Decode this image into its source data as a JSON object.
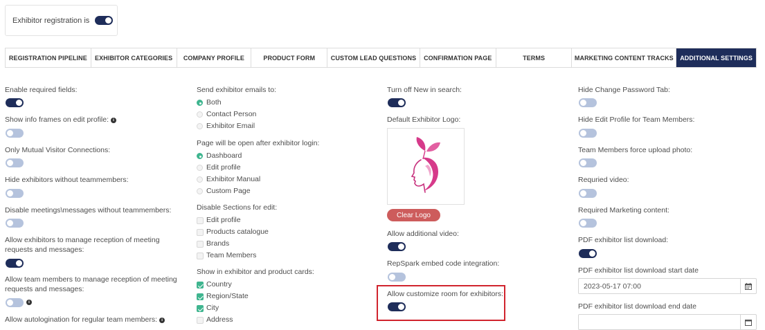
{
  "registration": {
    "label": "Exhibitor registration is",
    "enabled": true
  },
  "tabs": [
    {
      "label": "REGISTRATION PIPELINE",
      "active": false
    },
    {
      "label": "EXHIBITOR CATEGORIES",
      "active": false
    },
    {
      "label": "COMPANY PROFILE",
      "active": false
    },
    {
      "label": "PRODUCT FORM",
      "active": false
    },
    {
      "label": "CUSTOM LEAD QUESTIONS",
      "active": false
    },
    {
      "label": "CONFIRMATION PAGE",
      "active": false
    },
    {
      "label": "TERMS",
      "active": false
    },
    {
      "label": "MARKETING CONTENT TRACKS",
      "active": false
    },
    {
      "label": "ADDITIONAL SETTINGS",
      "active": true
    }
  ],
  "col1": [
    {
      "label": "Enable required fields:",
      "on": true
    },
    {
      "label": "Show info frames on edit profile:",
      "on": false
    },
    {
      "label": "Only Mutual Visitor Connections:",
      "on": false
    },
    {
      "label": "Hide exhibitors without teammembers:",
      "on": false
    },
    {
      "label": "Disable meetings\\messages without teammembers:",
      "on": false
    },
    {
      "label": "Allow exhibitors to manage reception of meeting requests and messages:",
      "on": true
    },
    {
      "label": "Allow team members to manage reception of meeting requests and messages:",
      "on": false
    },
    {
      "label": "Allow autologination for regular team members:"
    }
  ],
  "col2": {
    "emails": {
      "title": "Send exhibitor emails to:",
      "options": [
        "Both",
        "Contact Person",
        "Exhibitor Email"
      ],
      "selected": 0
    },
    "after_login": {
      "title": "Page will be open after exhibitor login:",
      "options": [
        "Dashboard",
        "Edit profile",
        "Exhibitor Manual",
        "Custom Page"
      ],
      "selected": 0
    },
    "disable_sections": {
      "title": "Disable Sections for edit:",
      "options": [
        "Edit profile",
        "Products catalogue",
        "Brands",
        "Team Members"
      ]
    },
    "show_in_cards": {
      "title": "Show in exhibitor and product cards:",
      "options": [
        "Country",
        "Region/State",
        "City",
        "Address"
      ],
      "checked": [
        true,
        true,
        true,
        false
      ]
    }
  },
  "col3": {
    "turn_off_new": {
      "label": "Turn off New in search:",
      "on": true
    },
    "default_logo": {
      "label": "Default Exhibitor Logo:"
    },
    "clear_logo": "Clear Logo",
    "additional_video": {
      "label": "Allow additional video:",
      "on": true
    },
    "repspark": {
      "label": "RepSpark embed code integration:",
      "on": false
    },
    "customize_room": {
      "label": "Allow customize room for exhibitors:",
      "on": true
    }
  },
  "col4": {
    "toggles": [
      {
        "label": "Hide Change Password Tab:",
        "on": false
      },
      {
        "label": "Hide Edit Profile for Team Members:",
        "on": false
      },
      {
        "label": "Team Members force upload photo:",
        "on": false
      },
      {
        "label": "Requried video:",
        "on": false
      },
      {
        "label": "Required Marketing content:",
        "on": false
      },
      {
        "label": "PDF exhibitor list download:",
        "on": true
      }
    ],
    "start_date": {
      "label": "PDF exhibitor list download start date",
      "value": "2023-05-17 07:00"
    },
    "end_date": {
      "label": "PDF exhibitor list download end date"
    }
  },
  "colors": {
    "primary": "#1e2d5a",
    "toggle_off": "#b5c3dd",
    "checked": "#3fb58f",
    "danger": "#cd5c5c",
    "highlight": "#d0232d"
  }
}
